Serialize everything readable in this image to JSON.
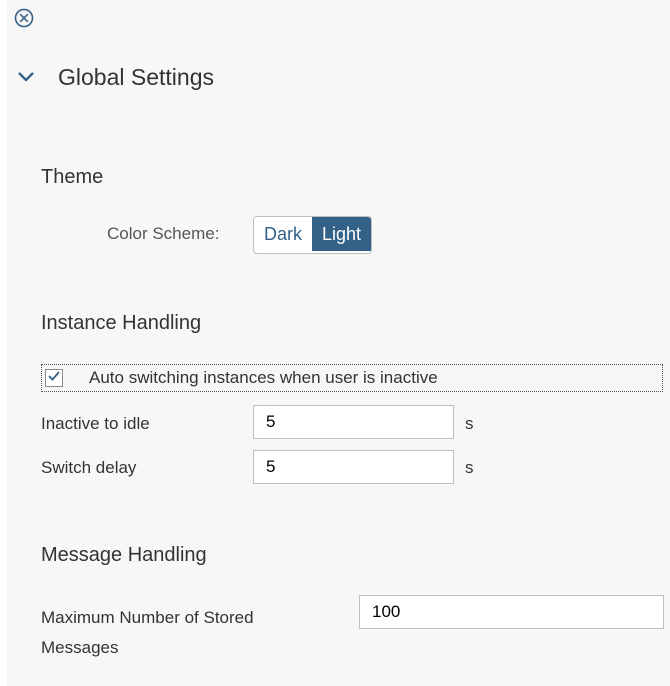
{
  "header": {
    "close_icon": "close-circle-icon",
    "expand_icon": "chevron-down-icon",
    "title": "Global Settings"
  },
  "theme": {
    "title": "Theme",
    "color_scheme_label": "Color Scheme:",
    "options": [
      "Dark",
      "Light"
    ],
    "selected": "Light",
    "accent_color": "#346187"
  },
  "instance_handling": {
    "title": "Instance Handling",
    "auto_switch_label": "Auto switching instances when user is inactive",
    "auto_switch_checked": true,
    "inactive_to_idle_label": "Inactive to idle",
    "inactive_to_idle_value": "5",
    "inactive_to_idle_unit": "s",
    "switch_delay_label": "Switch delay",
    "switch_delay_value": "5",
    "switch_delay_unit": "s"
  },
  "message_handling": {
    "title": "Message Handling",
    "max_stored_label_line1": "Maximum Number of Stored",
    "max_stored_label_line2": "Messages",
    "max_stored_value": "100"
  }
}
